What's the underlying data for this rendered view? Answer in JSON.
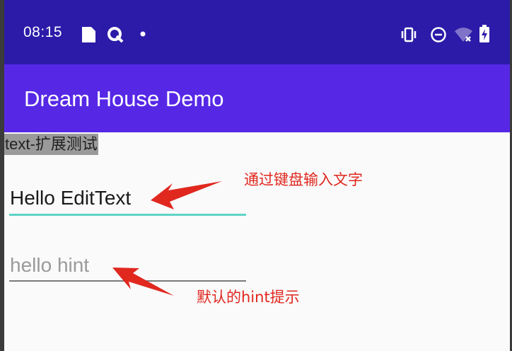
{
  "status_bar": {
    "time": "08:15",
    "left_icons": [
      "sim-card-icon",
      "app-notification-icon",
      "dot-icon"
    ],
    "right_icons": [
      "vibrate-icon",
      "do-not-disturb-icon",
      "wifi-no-connection-icon",
      "battery-charging-icon"
    ],
    "background": "#2c1ba8"
  },
  "app_bar": {
    "title": "Dream House Demo",
    "background": "#5628e6"
  },
  "content": {
    "text_label": "text-扩展测试",
    "edit_text_1_value": "Hello EditText",
    "edit_text_1_underline": "#5fd3c6",
    "edit_text_2_placeholder": "hello hint"
  },
  "annotations": {
    "keyboard_input": "通过键盘输入文字",
    "default_hint": "默认的hint提示",
    "color": "#e0281f"
  }
}
